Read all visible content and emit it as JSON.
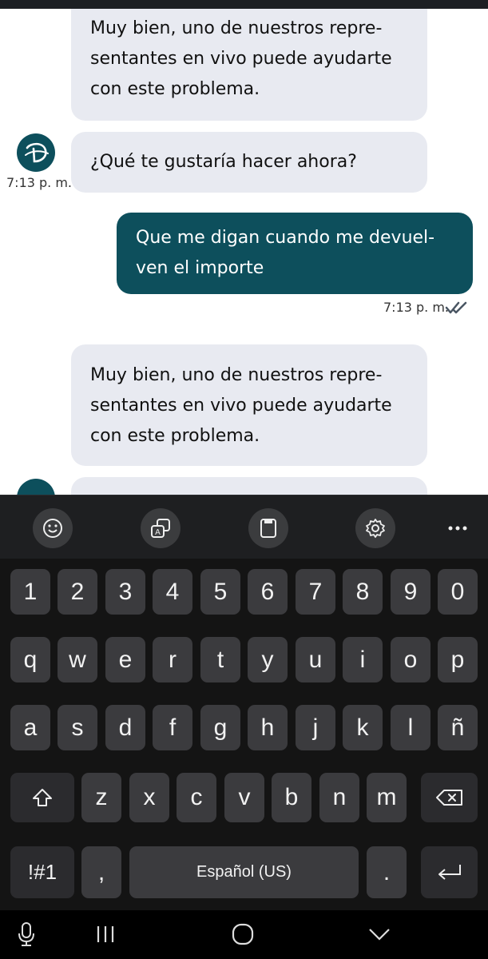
{
  "messages": [
    {
      "type": "incoming",
      "text": "Muy bien, uno de nuestros repre-\nsentantes en vivo puede ayudarte\ncon este problema."
    },
    {
      "type": "incoming",
      "text": "¿Qué te gustaría hacer ahora?",
      "time": "7:13 p. m."
    },
    {
      "type": "outgoing",
      "text": "Que me digan cuando me devuel-\nven el importe",
      "time": "7:13 p. m."
    },
    {
      "type": "incoming",
      "text": "Muy bien, uno de nuestros repre-\nsentantes en vivo puede ayudarte\ncon este problema."
    }
  ],
  "keyboard": {
    "toolbar": [
      "emoji-icon",
      "translate-icon",
      "clipboard-icon",
      "settings-icon",
      "more-icon"
    ],
    "row_numbers": [
      "1",
      "2",
      "3",
      "4",
      "5",
      "6",
      "7",
      "8",
      "9",
      "0"
    ],
    "row_top": [
      "q",
      "w",
      "e",
      "r",
      "t",
      "y",
      "u",
      "i",
      "o",
      "p"
    ],
    "row_middle": [
      "a",
      "s",
      "d",
      "f",
      "g",
      "h",
      "j",
      "k",
      "l",
      "ñ"
    ],
    "row_bottom": [
      "z",
      "x",
      "c",
      "v",
      "b",
      "n",
      "m"
    ],
    "symbols_label": "!#1",
    "comma_label": ",",
    "space_label": "Español (US)",
    "period_label": "."
  },
  "colors": {
    "accent": "#0d4f5c",
    "incoming_bubble": "#e8eaf1",
    "keyboard_bg": "#141414",
    "key": "#3b3b3e"
  }
}
